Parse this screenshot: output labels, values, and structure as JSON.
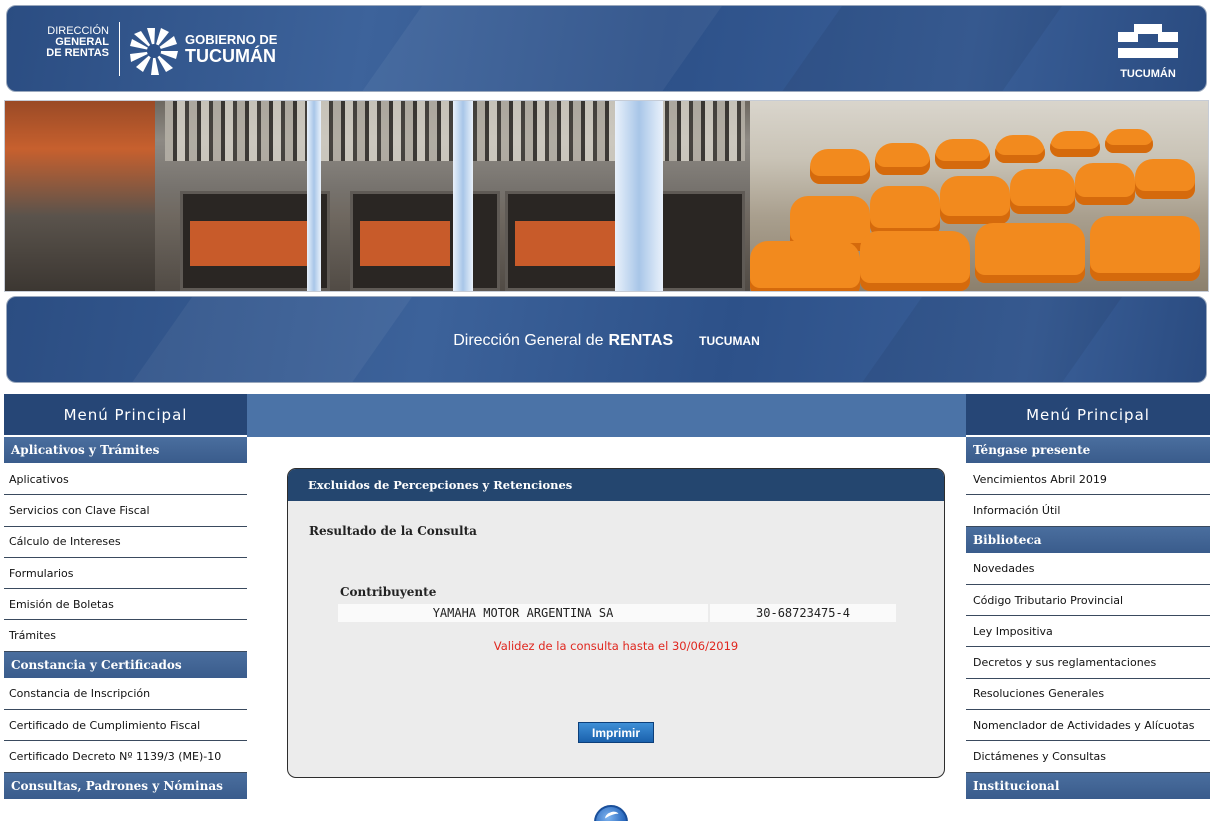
{
  "header": {
    "dgr_logo_lines": [
      "DIRECCIÓN",
      "GENERAL",
      "DE RENTAS"
    ],
    "gob_line1": "GOBIERNO DE",
    "gob_line2": "TUCUMÁN",
    "right_logo_text": "TUCUMÁN"
  },
  "title_band": {
    "part1": "Dirección General de",
    "part2": "RENTAS",
    "part3": "TUCUMAN"
  },
  "left_menu": {
    "header": "Menú Principal",
    "sections": [
      {
        "title": "Aplicativos y Trámites",
        "items": [
          "Aplicativos",
          "Servicios con Clave Fiscal",
          "Cálculo de Intereses",
          "Formularios",
          "Emisión de Boletas",
          "Trámites"
        ]
      },
      {
        "title": "Constancia y Certificados",
        "items": [
          "Constancia de Inscripción",
          "Certificado de Cumplimiento Fiscal",
          "Certificado Decreto Nº 1139/3 (ME)-10"
        ]
      },
      {
        "title": "Consultas, Padrones y Nóminas",
        "items": []
      }
    ]
  },
  "right_menu": {
    "header": "Menú Principal",
    "sections": [
      {
        "title": "Téngase presente",
        "items": [
          "Vencimientos Abril 2019",
          "Información Útil"
        ]
      },
      {
        "title": "Biblioteca",
        "items": [
          "Novedades",
          "Código Tributario Provincial",
          "Ley Impositiva",
          "Decretos y sus reglamentaciones",
          "Resoluciones Generales",
          "Nomenclador de Actividades y Alícuotas",
          "Dictámenes y Consultas"
        ]
      },
      {
        "title": "Institucional",
        "items": []
      }
    ]
  },
  "panel": {
    "title": "Excluidos de Percepciones y Retenciones",
    "subtitle": "Resultado de la Consulta",
    "contributor_label": "Contribuyente",
    "contributor_name": "YAMAHA MOTOR ARGENTINA SA",
    "contributor_cuit": "30-68723475-4",
    "validity_text": "Validez de la consulta hasta el 30/06/2019",
    "print_label": "Imprimir"
  },
  "colors": {
    "header_blue": "#2b4d82",
    "menu_header": "#264676",
    "menu_section": "#3a5c8c",
    "center_bar": "#4b73a7",
    "panel_head": "#24466f",
    "validity_red": "#e0271f",
    "print_button": "#1a61ad"
  },
  "icons": {
    "gob_logo": "sunburst-logo-icon",
    "right_logo": "tucuman-bars-logo-icon",
    "bottom_icon": "info-circle-icon"
  }
}
